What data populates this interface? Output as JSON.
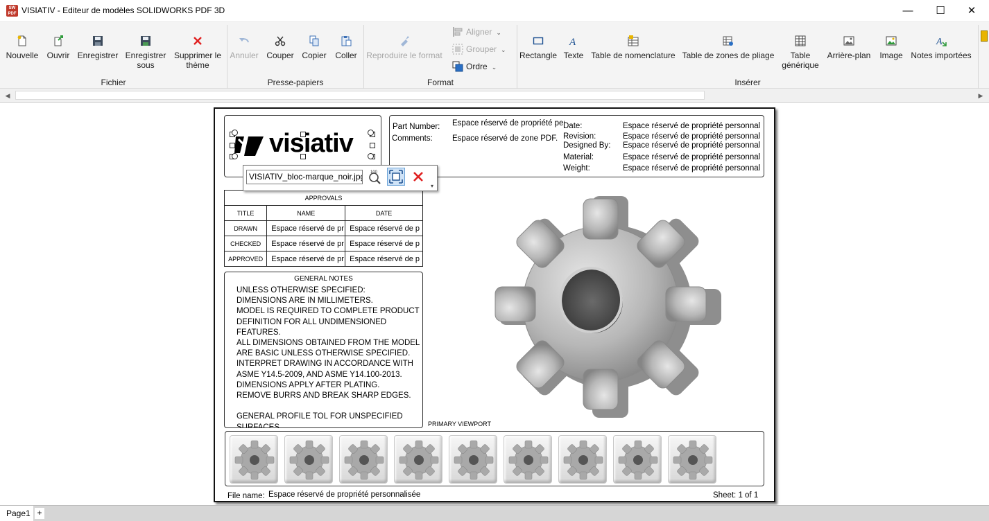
{
  "window": {
    "title": "VISIATIV - Editeur de modèles SOLIDWORKS PDF 3D",
    "icon_label": "SW PDF",
    "minimize": "—",
    "maximize": "☐",
    "close": "✕"
  },
  "ribbon": {
    "groups": {
      "fichier": "Fichier",
      "presse_papiers": "Presse-papiers",
      "format": "Format",
      "inserer": "Insérer"
    },
    "buttons": {
      "nouvelle": "Nouvelle",
      "ouvrir": "Ouvrir",
      "enregistrer": "Enregistrer",
      "enregistrer_sous_1": "Enregistrer",
      "enregistrer_sous_2": "sous",
      "supprimer_theme_1": "Supprimer le",
      "supprimer_theme_2": "thème",
      "annuler": "Annuler",
      "couper": "Couper",
      "copier": "Copier",
      "coller": "Coller",
      "reproduire_format": "Reproduire le format",
      "aligner": "Aligner",
      "grouper": "Grouper",
      "ordre": "Ordre",
      "rectangle": "Rectangle",
      "texte": "Texte",
      "table_nomenclature": "Table de nomenclature",
      "table_zones_pliage": "Table de zones de pliage",
      "table_generique_1": "Table",
      "table_generique_2": "générique",
      "arriere_plan": "Arrière-plan",
      "image": "Image",
      "notes_importees": "Notes importées"
    }
  },
  "sheet": {
    "logo_text": "visiativ",
    "image_toolbar": {
      "filename": "VISIATIV_bloc-marque_noir.jpg",
      "zoom_label": "100"
    },
    "info": {
      "part_number_label": "Part Number:",
      "part_number_value": "Espace réservé de propriété per",
      "comments_label": "Comments:",
      "comments_value": "Espace réservé de zone PDF.",
      "date_label": "Date:",
      "date_value": "Espace réservé de propriété personnal",
      "revision_label": "Revision:",
      "revision_value": "Espace réservé de propriété personnal",
      "designed_by_label": "Designed By:",
      "designed_by_value": "Espace réservé de propriété personnal",
      "material_label": "Material:",
      "material_value": "Espace réservé de propriété personnal",
      "weight_label": "Weight:",
      "weight_value": "Espace réservé de propriété personnal"
    },
    "approvals": {
      "title": "APPROVALS",
      "col_title": "TITLE",
      "col_name": "NAME",
      "col_date": "DATE",
      "rows": [
        {
          "title": "DRAWN",
          "name": "Espace réservé de pr",
          "date": "Espace réservé de p"
        },
        {
          "title": "CHECKED",
          "name": "Espace réservé de pr",
          "date": "Espace réservé de p"
        },
        {
          "title": "APPROVED",
          "name": "Espace réservé de pr",
          "date": "Espace réservé de p"
        }
      ]
    },
    "general_notes": {
      "title": "GENERAL NOTES",
      "lines": [
        "UNLESS OTHERWISE SPECIFIED:",
        "DIMENSIONS ARE IN MILLIMETERS.",
        "MODEL IS REQUIRED TO COMPLETE PRODUCT",
        "DEFINITION FOR ALL UNDIMENSIONED",
        "FEATURES.",
        "ALL DIMENSIONS OBTAINED FROM THE MODEL",
        "ARE BASIC UNLESS OTHERWISE SPECIFIED.",
        "INTERPRET DRAWING IN ACCORDANCE WITH",
        "ASME Y14.5-2009, AND ASME Y14.100-2013.",
        "DIMENSIONS APPLY AFTER PLATING.",
        "REMOVE BURRS AND BREAK SHARP EDGES.",
        "",
        "GENERAL PROFILE TOL FOR UNSPECIFIED",
        "SURFACES"
      ]
    },
    "primary_viewport_label": "PRIMARY VIEWPORT",
    "thumbnail_count": 9,
    "footer": {
      "file_name_label": "File name:",
      "file_name_value": "Espace réservé de propriété personnalisée",
      "sheet_label": "Sheet: 1 of 1"
    }
  },
  "pages": {
    "tab": "Page1",
    "add": "+"
  },
  "colors": {
    "ribbon_bg": "#f4f4f4",
    "delete_red": "#e02020",
    "gear_grey": "#a9a9a9"
  }
}
